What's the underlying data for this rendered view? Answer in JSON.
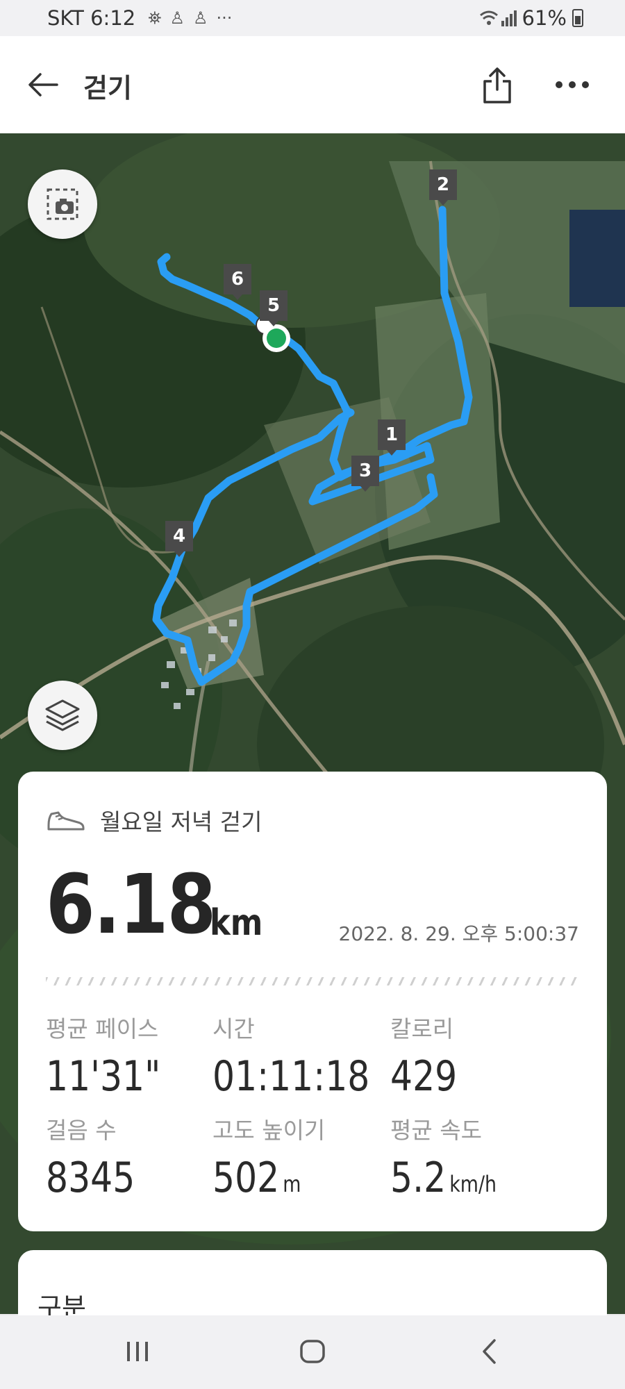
{
  "status_bar": {
    "carrier_time": "SKT 6:12",
    "notifications": [
      "⛯",
      "♙",
      "♙"
    ],
    "more": "···",
    "signal": "📶",
    "battery_percent": "61%"
  },
  "app_bar": {
    "title": "걷기",
    "back_icon": "arrow-left",
    "share_icon": "share",
    "more_icon": "more-horizontal"
  },
  "map": {
    "route_color": "#2a9df4",
    "km_markers": [
      "1",
      "2",
      "3",
      "4",
      "5",
      "6"
    ],
    "start_marker_color": "#1ea85a"
  },
  "summary": {
    "activity_name": "월요일 저녁 걷기",
    "distance": "6.18",
    "distance_unit": "km",
    "datetime": "2022. 8. 29. 오후 5:00:37",
    "stats": [
      {
        "label": "평균 페이스",
        "value": "11'31\"",
        "unit": ""
      },
      {
        "label": "시간",
        "value": "01:11:18",
        "unit": ""
      },
      {
        "label": "칼로리",
        "value": "429",
        "unit": ""
      },
      {
        "label": "걸음 수",
        "value": "8345",
        "unit": ""
      },
      {
        "label": "고도 높이기",
        "value": "502",
        "unit": "m"
      },
      {
        "label": "평균 속도",
        "value": "5.2",
        "unit": "km/h"
      }
    ]
  },
  "section": {
    "title": "구분"
  }
}
